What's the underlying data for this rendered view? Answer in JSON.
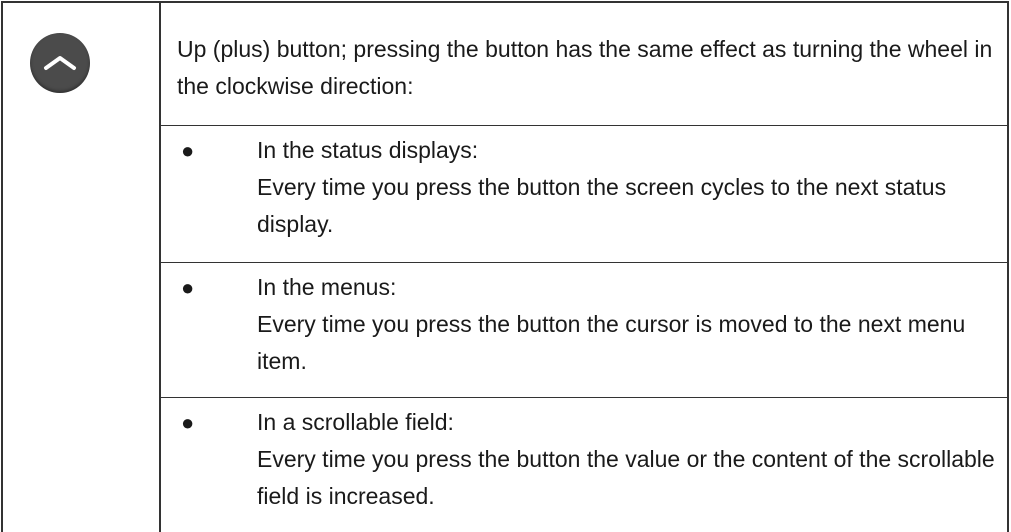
{
  "icon": "chevron-up-icon",
  "colors": {
    "icon_bg": "#4b4b4b",
    "chevron": "#ffffff",
    "border": "#333333"
  },
  "description": {
    "intro": "Up (plus) button; pressing the button has the same effect as turning the wheel in the clockwise direction:",
    "items": [
      {
        "heading": "In the status displays:",
        "body": "Every time you press the button the screen cycles to the next status display."
      },
      {
        "heading": "In the menus:",
        "body": "Every time you press the button the cursor is moved to the next menu item."
      },
      {
        "heading": "In a scrollable field:",
        "body": "Every time you press the button the value or the content of the scrollable field is increased."
      }
    ]
  }
}
